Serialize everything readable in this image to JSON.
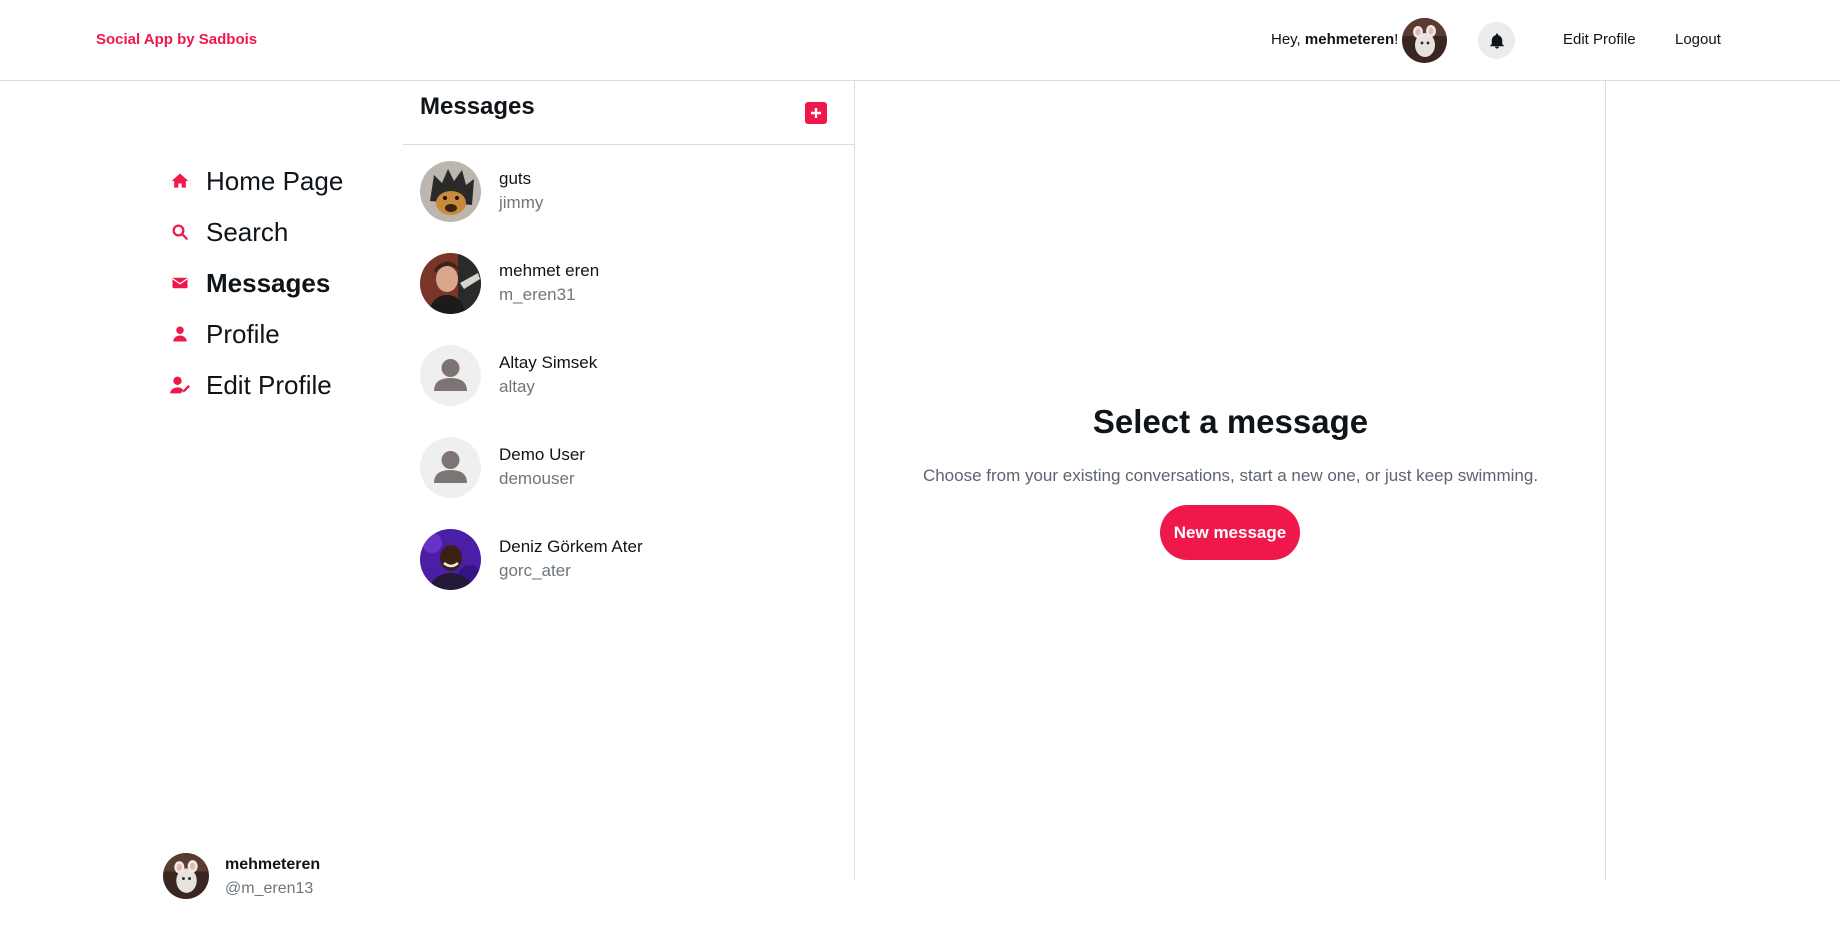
{
  "header": {
    "brand": "Social App by Sadbois",
    "greeting_prefix": "Hey, ",
    "greeting_user": "mehmeteren",
    "greeting_suffix": "!",
    "edit_profile": "Edit Profile",
    "logout": "Logout",
    "bell_icon": "bell-icon"
  },
  "nav": {
    "items": [
      {
        "label": "Home Page",
        "icon": "home-icon"
      },
      {
        "label": "Search",
        "icon": "search-icon"
      },
      {
        "label": "Messages",
        "icon": "envelope-icon",
        "active": true
      },
      {
        "label": "Profile",
        "icon": "user-icon"
      },
      {
        "label": "Edit Profile",
        "icon": "user-edit-icon"
      }
    ]
  },
  "current_user": {
    "name": "mehmeteren",
    "handle": "@m_eren13"
  },
  "messages": {
    "title": "Messages",
    "new_icon": "plus-icon",
    "conversations": [
      {
        "name": "guts",
        "handle": "jimmy"
      },
      {
        "name": "mehmet eren",
        "handle": "m_eren31"
      },
      {
        "name": "Altay Simsek",
        "handle": "altay"
      },
      {
        "name": "Demo User",
        "handle": "demouser"
      },
      {
        "name": "Deniz Görkem Ater",
        "handle": "gorc_ater"
      }
    ]
  },
  "empty_state": {
    "title": "Select a message",
    "subtitle": "Choose from your existing conversations, start a new one, or just keep swimming.",
    "button": "New message"
  },
  "colors": {
    "accent": "#f0184a",
    "text": "#0f1419",
    "muted": "#6e767d",
    "border": "#dcdcdc"
  }
}
